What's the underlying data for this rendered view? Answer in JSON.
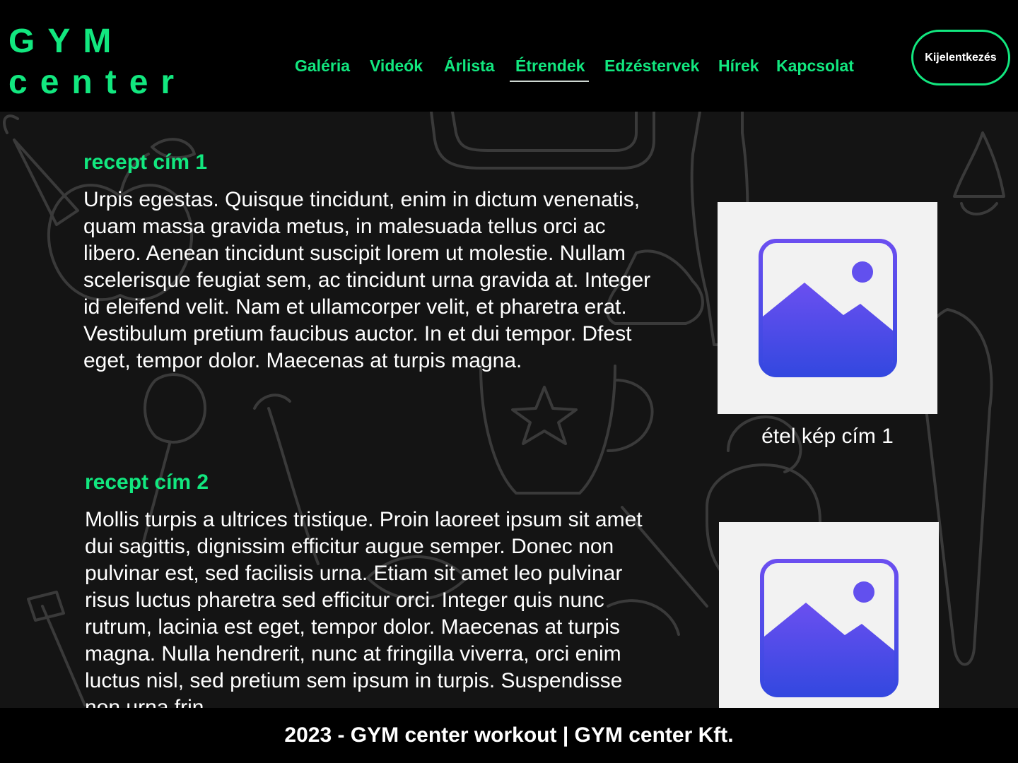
{
  "logo": {
    "line1": "GYM",
    "line2": "center"
  },
  "nav": {
    "items": [
      {
        "label": "Galéria"
      },
      {
        "label": "Videók"
      },
      {
        "label": "Árlista"
      },
      {
        "label": "Étrendek",
        "active": true
      },
      {
        "label": "Edzéstervek"
      },
      {
        "label": "Hírek"
      },
      {
        "label": "Kapcsolat"
      }
    ],
    "logout_label": "Kijelentkezés"
  },
  "recipes": [
    {
      "title": "recept cím 1",
      "text": "Urpis egestas. Quisque tincidunt, enim in dictum venenatis, quam massa gravida metus, in malesuada tellus orci ac libero. Aenean tincidunt suscipit lorem ut molestie. Nullam scelerisque feugiat sem, ac tincidunt urna gravida at. Integer id eleifend velit. Nam et ullamcorper velit, et pharetra erat. Vestibulum pretium faucibus auctor. In et dui tempor.  Dfest eget, tempor dolor. Maecenas at turpis magna.",
      "image_caption": "étel kép cím 1",
      "image_icon": "image-placeholder-icon"
    },
    {
      "title": "recept cím 2",
      "text": "Mollis turpis a ultrices tristique. Proin laoreet ipsum sit amet dui sagittis, dignissim efficitur augue semper. Donec non pulvinar est, sed facilisis urna. Etiam sit amet leo pulvinar risus luctus pharetra sed efficitur orci. Integer quis nunc rutrum, lacinia est eget, tempor dolor. Maecenas at turpis magna. Nulla hendrerit, nunc at fringilla viverra, orci enim luctus nisl, sed pretium sem ipsum in turpis. Suspendisse non urna frin",
      "image_icon": "image-placeholder-icon"
    }
  ],
  "footer": {
    "text": "2023 - GYM center workout | GYM center Kft."
  },
  "colors": {
    "accent": "#12e77f",
    "background": "#000000",
    "content_bg": "#141414",
    "image_bg": "#f2f2f2",
    "icon_top": "#6b4ff0",
    "icon_bottom": "#3448e0"
  }
}
